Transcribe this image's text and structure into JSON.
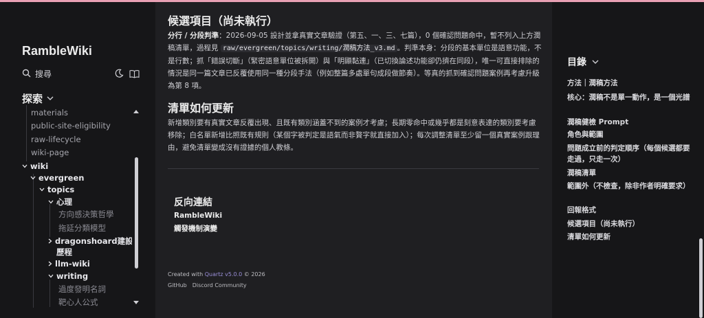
{
  "site": {
    "title": "RambleWiki",
    "search_label": "搜尋"
  },
  "explorer": {
    "title": "探索",
    "rows": [
      {
        "label": "materials",
        "kind": "file"
      },
      {
        "label": "public-site-eligibility",
        "kind": "file"
      },
      {
        "label": "raw-lifecycle",
        "kind": "file"
      },
      {
        "label": "wiki-page",
        "kind": "file"
      },
      {
        "label": "wiki",
        "kind": "folder"
      },
      {
        "label": "evergreen",
        "kind": "folder"
      },
      {
        "label": "topics",
        "kind": "folder"
      },
      {
        "label": "心理",
        "kind": "folder"
      },
      {
        "label": "方向感決策哲學",
        "kind": "file"
      },
      {
        "label": "拖延分類模型",
        "kind": "file"
      },
      {
        "label": "dragonshoard建設",
        "kind": "folder"
      },
      {
        "label": "歷程",
        "kind": "folder"
      },
      {
        "label": "llm-wiki",
        "kind": "folder"
      },
      {
        "label": "writing",
        "kind": "folder"
      },
      {
        "label": "過度發明名詞",
        "kind": "file"
      },
      {
        "label": "靶心人公式",
        "kind": "file"
      }
    ]
  },
  "main": {
    "h_candidates": "候選項目（尚未執行）",
    "p1": {
      "lead": "分行 / 分段判準",
      "t1": "：2026-09-05 設計並拿真實文章驗證（第五、一、三、七篇），0 個確認問題命中，暫不列入上方潤稿清單，過程見 ",
      "code": "raw/evergreen/topics/writing/潤稿方法_v3.md",
      "t2": "。判準本身：分段的基本單位是語意功能，不是行數；抓「錯誤切斷」（緊密語意單位被拆開）與「明顯黏連」（已切換論述功能卻仍擠在同段），唯一可直接排除的情況是同一篇文章已反覆使用同一種分段手法（例如整篇多處單句成段做節奏）。等真的抓到確認問題案例再考慮升級為第 8 項。"
    },
    "h_update": "清單如何更新",
    "p2": "新增類別要有真實文章反覆出現、且既有類別涵蓋不到的案例才考慮；長期零命中或幾乎都是刻意表達的類別要考慮移除；白名單新增比照既有規則（某個字被判定是語氣而非贅字就直接加入）；每次調整清單至少留一個真實案例跟理由，避免清單變成沒有證據的個人教條。",
    "backlinks_title": "反向連結",
    "backlinks": [
      "RambleWiki",
      "觸發機制演變"
    ],
    "footer": {
      "created_prefix": "Created with ",
      "quartz": "Quartz v5.0.0",
      "created_suffix": " © 2026",
      "links": [
        "GitHub",
        "Discord Community"
      ]
    }
  },
  "toc": {
    "title": "目錄",
    "items": [
      "方法｜潤稿方法",
      "核心：潤稿不是單一動作，是一個光譜",
      "潤稿健檢 Prompt",
      "角色與範圍",
      "問題成立前的判定順序（每個候選都要走過，只走一次）",
      "潤稿清單",
      "範圍外（不檢查，除非作者明確要求）",
      "回報格式",
      "候選項目（尚未執行）",
      "清單如何更新"
    ]
  },
  "colors": {
    "accent_bar": "#e8a0b4",
    "quartz_link": "#9a8fd9"
  }
}
